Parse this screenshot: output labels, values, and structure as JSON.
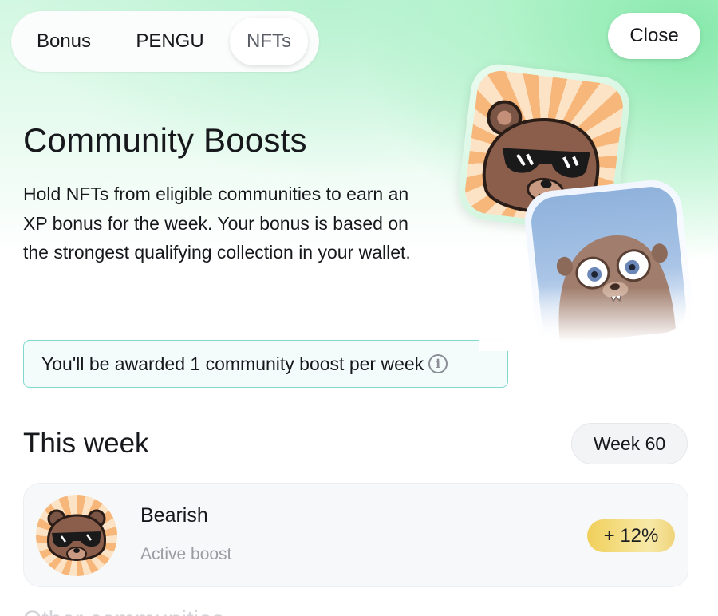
{
  "tabs": [
    {
      "label": "Bonus",
      "active": false
    },
    {
      "label": "PENGU",
      "active": false
    },
    {
      "label": "NFTs",
      "active": true
    }
  ],
  "close_label": "Close",
  "header": {
    "title": "Community Boosts",
    "description": "Hold NFTs from eligible communities to earn an XP bonus for the week. Your bonus is based on the strongest qualifying collection in your wallet."
  },
  "award_notice": {
    "text": "You'll be awarded 1 community boost per week",
    "icon": "info-icon"
  },
  "this_week": {
    "title": "This week",
    "week_label": "Week 60",
    "boost": {
      "name": "Bearish",
      "status": "Active boost",
      "bonus": "+ 12%"
    }
  },
  "next_section_title": "Other communities",
  "colors": {
    "accent_border": "#7fd9cf",
    "bonus_gold": "#f0cf5a",
    "glow_green": "#78e6a0"
  }
}
